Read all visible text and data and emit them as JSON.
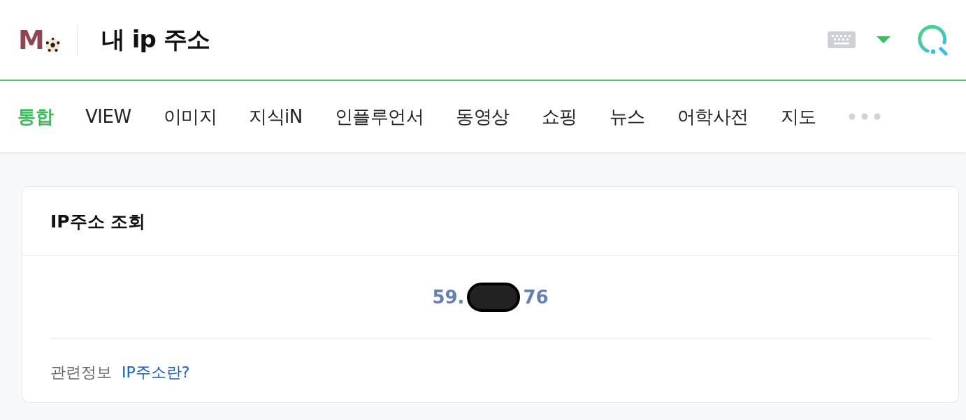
{
  "header": {
    "logo_letter": "M",
    "query": "내 ip 주소"
  },
  "tabs": [
    {
      "label": "통합",
      "selected": true
    },
    {
      "label": "VIEW",
      "selected": false
    },
    {
      "label": "이미지",
      "selected": false
    },
    {
      "label": "지식iN",
      "selected": false
    },
    {
      "label": "인플루언서",
      "selected": false
    },
    {
      "label": "동영상",
      "selected": false
    },
    {
      "label": "쇼핑",
      "selected": false
    },
    {
      "label": "뉴스",
      "selected": false
    },
    {
      "label": "어학사전",
      "selected": false
    },
    {
      "label": "지도",
      "selected": false
    }
  ],
  "card": {
    "title": "IP주소 조회",
    "ip_start": "59.",
    "ip_end": "76",
    "related_label": "관련정보",
    "related_link": "IP주소란?"
  }
}
